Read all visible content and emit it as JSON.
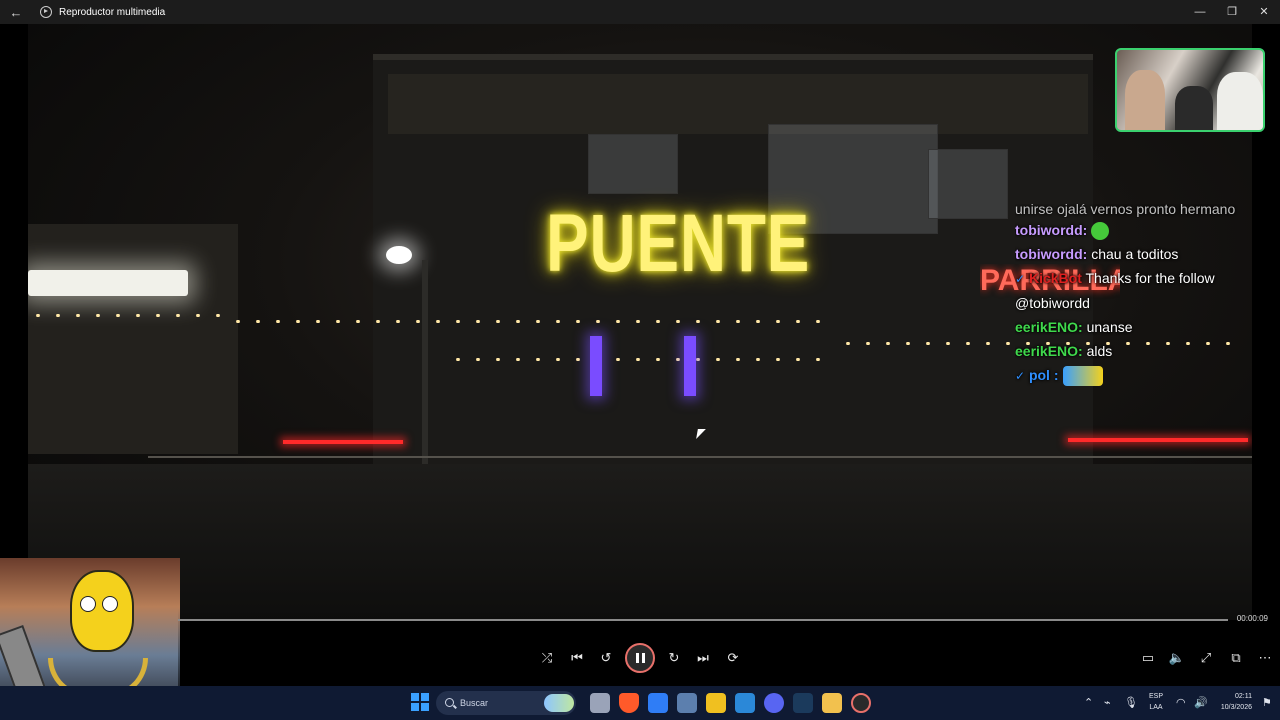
{
  "window": {
    "title": "Reproductor multimedia",
    "back_glyph": "←",
    "minimize_glyph": "—",
    "maximize_glyph": "❐",
    "close_glyph": "✕"
  },
  "video": {
    "neon_sign": "PUENTE",
    "neon_sign_2": "PARRILLA"
  },
  "chat": {
    "cut_line": "unirse ojalá vernos pronto hermano",
    "messages": [
      {
        "user": "tobiwordd:",
        "text": "",
        "user_color": "purple",
        "emote": "green-emote"
      },
      {
        "user": "tobiwordd:",
        "text": " chau a toditos",
        "user_color": "purple"
      },
      {
        "user": "KickBot",
        "text": " Thanks for the follow",
        "user_color": "red",
        "badge": "✓"
      },
      {
        "user": "",
        "text": "@tobiwordd",
        "user_color": "none"
      },
      {
        "user": "eerikENO:",
        "text": " unanse",
        "user_color": "green"
      },
      {
        "user": "eerikENO:",
        "text": " alds",
        "user_color": "green"
      },
      {
        "user": "pol :",
        "text": "",
        "user_color": "blue",
        "badge": "✓",
        "emote": "wide-emote"
      }
    ]
  },
  "player": {
    "time": "00:00:09",
    "progress": 0.0,
    "buttons": {
      "shuffle": "⤮",
      "previous": "⏮",
      "rewind": "↺",
      "forward": "↻",
      "next": "⏭",
      "repeat": "⟳",
      "miniplayer": "▭",
      "volume": "🔈",
      "fullscreen": "⤢",
      "cast": "⧉",
      "more": "⋯"
    }
  },
  "taskbar": {
    "search_placeholder": "Buscar",
    "language_top": "ESP",
    "language_bottom": "LAA",
    "clock_time": "02:11",
    "clock_date": "10/3/2026",
    "tray_chevron": "⌃"
  },
  "colors": {
    "accent": "#e8706a",
    "chat_purple": "#c79cff",
    "chat_green": "#3fd94c",
    "chat_red": "#e02020",
    "chat_blue": "#2f8fff"
  }
}
